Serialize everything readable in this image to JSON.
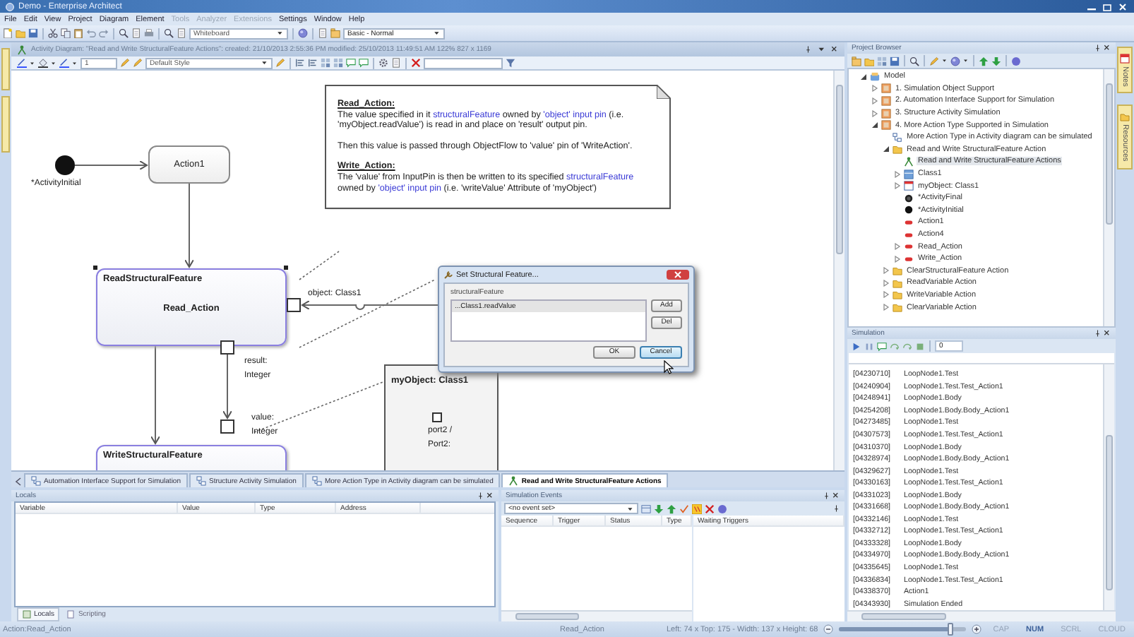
{
  "window": {
    "title": "Demo - Enterprise Architect"
  },
  "menu": [
    {
      "label": "File",
      "disabled": false
    },
    {
      "label": "Edit",
      "disabled": false
    },
    {
      "label": "View",
      "disabled": false
    },
    {
      "label": "Project",
      "disabled": false
    },
    {
      "label": "Diagram",
      "disabled": false
    },
    {
      "label": "Element",
      "disabled": false
    },
    {
      "label": "Tools",
      "disabled": true
    },
    {
      "label": "Analyzer",
      "disabled": true
    },
    {
      "label": "Extensions",
      "disabled": true
    },
    {
      "label": "Settings",
      "disabled": false
    },
    {
      "label": "Window",
      "disabled": false
    },
    {
      "label": "Help",
      "disabled": false
    }
  ],
  "toolbar": {
    "workspace": "Whiteboard",
    "perspective": "Basic - Normal"
  },
  "diagram_view": {
    "header": "Activity Diagram: \"Read and Write StructuralFeature Actions\":  created: 21/10/2013 2:55:36 PM  modified: 25/10/2013 11:49:51 AM   122%   827 x 1169",
    "font_size": "1",
    "style": "Default Style",
    "nodes": [
      {
        "kind": "initial",
        "label": "*ActivityInitial"
      },
      {
        "kind": "action",
        "label": "Action1"
      },
      {
        "kind": "feature_action",
        "type_label": "ReadStructuralFeature",
        "label": "Read_Action",
        "selected": true
      },
      {
        "kind": "feature_action",
        "type_label": "WriteStructuralFeature",
        "selected": false
      },
      {
        "kind": "object",
        "label": "myObject: Class1"
      }
    ],
    "pins": [
      {
        "label": "object: Class1"
      },
      {
        "label": "result: Integer"
      },
      {
        "label": "value: Integer"
      },
      {
        "label": "port2 / Port2:"
      }
    ],
    "note": {
      "sections": [
        {
          "heading": "Read_Action:",
          "paragraphs": [
            [
              {
                "kind": "plain",
                "text": "The value specified in it "
              },
              {
                "kind": "ref",
                "text": "structuralFeature"
              },
              {
                "kind": "plain",
                "text": " owned by "
              },
              {
                "kind": "ref",
                "text": "'object' input pin"
              },
              {
                "kind": "plain",
                "text": " (i.e. 'myObject.readValue') is read in and place on 'result' output pin."
              }
            ],
            [
              {
                "kind": "plain",
                "text": "Then this value is passed through ObjectFlow to 'value' pin of 'WriteAction'."
              }
            ]
          ]
        },
        {
          "heading": "Write_Action:",
          "paragraphs": [
            [
              {
                "kind": "plain",
                "text": "The 'value' from InputPin is then be written to its specified "
              },
              {
                "kind": "ref",
                "text": "structuralFeature"
              },
              {
                "kind": "plain",
                "text": " owned by "
              },
              {
                "kind": "ref",
                "text": "'object' input pin"
              },
              {
                "kind": "plain",
                "text": " (i.e. 'writeValue' Attribute of 'myObject')"
              }
            ]
          ]
        }
      ]
    },
    "dialog": {
      "title": "Set Structural Feature...",
      "field_label": "structuralFeature",
      "items": [
        "...Class1.readValue"
      ],
      "buttons": [
        {
          "label": "Add",
          "kind": "side",
          "focused": false
        },
        {
          "label": "Del",
          "kind": "side",
          "focused": false
        },
        {
          "label": "OK",
          "kind": "footer",
          "focused": false
        },
        {
          "label": "Cancel",
          "kind": "footer",
          "focused": true
        }
      ]
    },
    "tabs": [
      {
        "label": "Automation Interface Support for Simulation",
        "kind": "diagram",
        "selected": false
      },
      {
        "label": "Structure Activity Simulation",
        "kind": "diagram",
        "selected": false
      },
      {
        "label": "More Action Type in Activity diagram can be simulated",
        "kind": "diagram",
        "selected": false
      },
      {
        "label": "Read and Write StructuralFeature Actions",
        "kind": "activity",
        "selected": true
      }
    ]
  },
  "locals": {
    "title": "Locals",
    "columns": [
      "Variable",
      "Value",
      "Type",
      "Address"
    ],
    "tabs": [
      {
        "label": "Locals",
        "selected": true
      },
      {
        "label": "Scripting",
        "selected": false
      }
    ]
  },
  "simulation_events": {
    "title": "Simulation Events",
    "event_combo": "<no event set>",
    "columns": [
      "Sequence",
      "Trigger",
      "Status",
      "Type"
    ],
    "waiting_header": "Waiting Triggers"
  },
  "browser": {
    "title": "Project Browser",
    "tree": [
      {
        "label": "Model",
        "kind": "model",
        "expanded": true,
        "selected": false,
        "children": [
          {
            "label": "1. Simulation Object Support",
            "kind": "package",
            "expanded": false,
            "selected": false
          },
          {
            "label": "2. Automation Interface Support for Simulation",
            "kind": "package",
            "expanded": false,
            "selected": false
          },
          {
            "label": "3. Structure Activity Simulation",
            "kind": "package",
            "expanded": false,
            "selected": false
          },
          {
            "label": "4. More Action Type Supported in Simulation",
            "kind": "package",
            "expanded": true,
            "selected": false,
            "children": [
              {
                "label": "More Action Type in Activity diagram can be simulated",
                "kind": "diagram",
                "selected": false
              },
              {
                "label": "Read and Write StructuralFeature Action",
                "kind": "folder",
                "expanded": true,
                "selected": false,
                "children": [
                  {
                    "label": "Read and Write StructuralFeature Actions",
                    "kind": "activity",
                    "selected": true
                  },
                  {
                    "label": "Class1",
                    "kind": "class",
                    "expanded": false,
                    "selected": false
                  },
                  {
                    "label": "myObject: Class1",
                    "kind": "object",
                    "expanded": false,
                    "selected": false
                  },
                  {
                    "label": "*ActivityFinal",
                    "kind": "final",
                    "selected": false
                  },
                  {
                    "label": "*ActivityInitial",
                    "kind": "initial",
                    "selected": false
                  },
                  {
                    "label": "Action1",
                    "kind": "action",
                    "selected": false
                  },
                  {
                    "label": "Action4",
                    "kind": "action",
                    "selected": false
                  },
                  {
                    "label": "Read_Action",
                    "kind": "action",
                    "expanded": false,
                    "selected": false
                  },
                  {
                    "label": "Write_Action",
                    "kind": "action",
                    "expanded": false,
                    "selected": false
                  }
                ]
              },
              {
                "label": "ClearStructuralFeature Action",
                "kind": "folder",
                "expanded": false,
                "selected": false
              },
              {
                "label": "ReadVariable Action",
                "kind": "folder",
                "expanded": false,
                "selected": false
              },
              {
                "label": "WriteVariable Action",
                "kind": "folder",
                "expanded": false,
                "selected": false
              },
              {
                "label": "ClearVariable Action",
                "kind": "folder",
                "expanded": false,
                "selected": false
              }
            ]
          }
        ]
      }
    ]
  },
  "simulation": {
    "title": "Simulation",
    "step": "0",
    "log": [
      {
        "time": "[04230710]",
        "event": "LoopNode1.Test"
      },
      {
        "time": "[04240904]",
        "event": "LoopNode1.Test.Test_Action1"
      },
      {
        "time": "[04248941]",
        "event": "LoopNode1.Body"
      },
      {
        "time": "[04254208]",
        "event": "LoopNode1.Body.Body_Action1"
      },
      {
        "time": "[04273485]",
        "event": "LoopNode1.Test"
      },
      {
        "time": "[04307573]",
        "event": "LoopNode1.Test.Test_Action1"
      },
      {
        "time": "[04310370]",
        "event": "LoopNode1.Body"
      },
      {
        "time": "[04328974]",
        "event": "LoopNode1.Body.Body_Action1"
      },
      {
        "time": "[04329627]",
        "event": "LoopNode1.Test"
      },
      {
        "time": "[04330163]",
        "event": "LoopNode1.Test.Test_Action1"
      },
      {
        "time": "[04331023]",
        "event": "LoopNode1.Body"
      },
      {
        "time": "[04331668]",
        "event": "LoopNode1.Body.Body_Action1"
      },
      {
        "time": "[04332146]",
        "event": "LoopNode1.Test"
      },
      {
        "time": "[04332712]",
        "event": "LoopNode1.Test.Test_Action1"
      },
      {
        "time": "[04333328]",
        "event": "LoopNode1.Body"
      },
      {
        "time": "[04334970]",
        "event": "LoopNode1.Body.Body_Action1"
      },
      {
        "time": "[04335645]",
        "event": "LoopNode1.Test"
      },
      {
        "time": "[04336834]",
        "event": "LoopNode1.Test.Test_Action1"
      },
      {
        "time": "[04338370]",
        "event": "Action1"
      },
      {
        "time": "[04343930]",
        "event": "Simulation Ended"
      }
    ]
  },
  "side_tabs": [
    {
      "label": "Notes"
    },
    {
      "label": "Resources"
    }
  ],
  "status_bar": {
    "hint": "Action:Read_Action",
    "element": "Read_Action",
    "geometry": "Left: 74 x Top: 175 - Width: 137 x Height: 68",
    "zoom": {
      "level": 0.88
    },
    "indicators": [
      {
        "label": "CAP",
        "on": false
      },
      {
        "label": "NUM",
        "on": true
      },
      {
        "label": "SCRL",
        "on": false
      },
      {
        "label": "CLOUD",
        "on": false
      }
    ]
  }
}
